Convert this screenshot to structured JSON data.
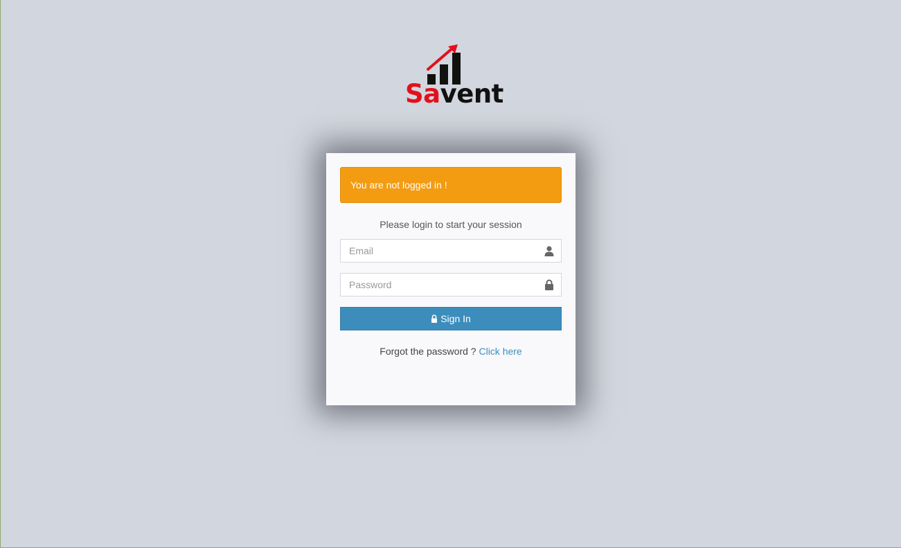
{
  "brand": {
    "logo_prefix": "Sa",
    "logo_suffix": "vent",
    "prefix_color": "#e3101b",
    "suffix_color": "#111111"
  },
  "alert": {
    "text": "You are not logged in !",
    "color": "#f39c12"
  },
  "login": {
    "message": "Please login to start your session",
    "email_placeholder": "Email",
    "email_icon": "user-icon",
    "password_placeholder": "Password",
    "password_icon": "lock-icon",
    "signin_label": "Sign In",
    "signin_icon": "lock-icon",
    "button_color": "#3c8dbc"
  },
  "forgot": {
    "text": "Forgot the password ?",
    "link_text": "Click here"
  }
}
